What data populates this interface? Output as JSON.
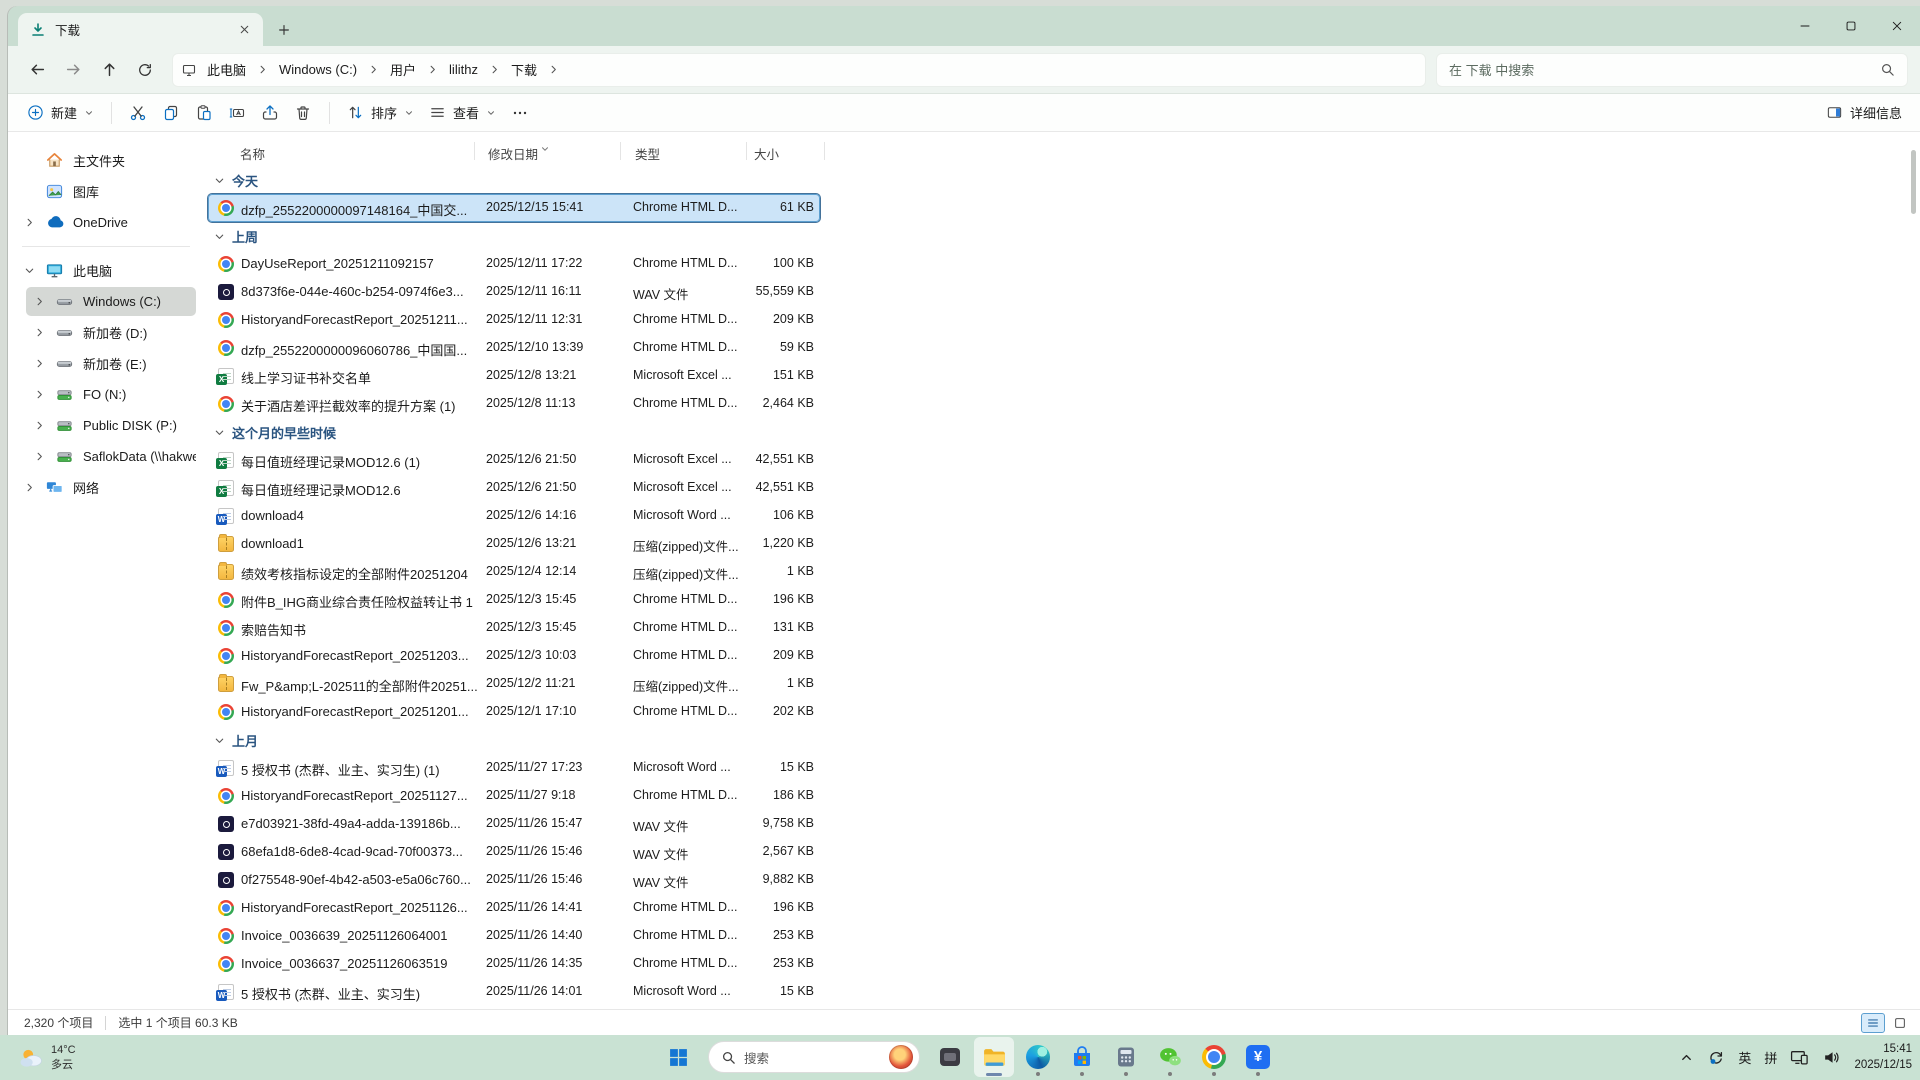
{
  "window": {
    "tab": {
      "icon": "download-icon",
      "label": "下载"
    },
    "controls": {
      "minimize_icon": "minimize-icon",
      "maximize_icon": "maximize-icon",
      "close_icon": "close-icon"
    }
  },
  "breadcrumb": {
    "device_icon": "computer-icon",
    "items": [
      "此电脑",
      "Windows (C:)",
      "用户",
      "lilithz",
      "下载"
    ]
  },
  "search": {
    "placeholder": "在 下载 中搜索",
    "icon": "search-icon"
  },
  "toolbar": {
    "new": "新建",
    "sort": "排序",
    "view": "查看",
    "details": "详细信息",
    "icons": [
      "new-plus-icon",
      "cut-icon",
      "copy-icon",
      "paste-icon",
      "rename-icon",
      "share-icon",
      "delete-icon",
      "sort-icon",
      "view-list-icon",
      "more-icon",
      "details-pane-icon"
    ]
  },
  "columns": {
    "name": "名称",
    "date": "修改日期",
    "type": "类型",
    "size": "大小"
  },
  "sidebar": {
    "items": [
      {
        "label": "主文件夹",
        "icon": "home-icon",
        "indent": 1,
        "chevron": ""
      },
      {
        "label": "图库",
        "icon": "gallery-icon",
        "indent": 1,
        "chevron": ""
      },
      {
        "label": "OneDrive",
        "icon": "onedrive-icon",
        "indent": 1,
        "chevron": "right",
        "divider_after": true
      },
      {
        "label": "此电脑",
        "icon": "pc-icon",
        "indent": 1,
        "chevron": "down"
      },
      {
        "label": "Windows (C:)",
        "icon": "drive-icon",
        "indent": 2,
        "chevron": "right",
        "selected": true
      },
      {
        "label": "新加卷 (D:)",
        "icon": "drive-icon",
        "indent": 2,
        "chevron": "right"
      },
      {
        "label": "新加卷 (E:)",
        "icon": "drive-icon",
        "indent": 2,
        "chevron": "right"
      },
      {
        "label": "FO (N:)",
        "icon": "network-drive-icon",
        "indent": 2,
        "chevron": "right"
      },
      {
        "label": "Public DISK (P:)",
        "icon": "network-drive-icon",
        "indent": 2,
        "chevron": "right"
      },
      {
        "label": "SaflokData (\\\\hakwe",
        "icon": "network-drive-icon",
        "indent": 2,
        "chevron": "right"
      },
      {
        "label": "网络",
        "icon": "network-icon",
        "indent": 1,
        "chevron": "right"
      }
    ]
  },
  "files": {
    "groups": [
      {
        "label": "今天",
        "rows": [
          {
            "name": "dzfp_2552200000097148164_中国交...",
            "date": "2025/12/15 15:41",
            "type": "Chrome HTML D...",
            "size": "61 KB",
            "kind": "chrome",
            "selected": true
          }
        ]
      },
      {
        "label": "上周",
        "rows": [
          {
            "name": "DayUseReport_20251211092157",
            "date": "2025/12/11 17:22",
            "type": "Chrome HTML D...",
            "size": "100 KB",
            "kind": "chrome"
          },
          {
            "name": "8d373f6e-044e-460c-b254-0974f6e3...",
            "date": "2025/12/11 16:11",
            "type": "WAV 文件",
            "size": "55,559 KB",
            "kind": "wav"
          },
          {
            "name": "HistoryandForecastReport_20251211...",
            "date": "2025/12/11 12:31",
            "type": "Chrome HTML D...",
            "size": "209 KB",
            "kind": "chrome"
          },
          {
            "name": "dzfp_2552200000096060786_中国国...",
            "date": "2025/12/10 13:39",
            "type": "Chrome HTML D...",
            "size": "59 KB",
            "kind": "chrome"
          },
          {
            "name": "线上学习证书补交名单",
            "date": "2025/12/8 13:21",
            "type": "Microsoft Excel ...",
            "size": "151 KB",
            "kind": "excel"
          },
          {
            "name": "关于酒店差评拦截效率的提升方案 (1)",
            "date": "2025/12/8 11:13",
            "type": "Chrome HTML D...",
            "size": "2,464 KB",
            "kind": "chrome"
          }
        ]
      },
      {
        "label": "这个月的早些时候",
        "rows": [
          {
            "name": "每日值班经理记录MOD12.6 (1)",
            "date": "2025/12/6 21:50",
            "type": "Microsoft Excel ...",
            "size": "42,551 KB",
            "kind": "excel"
          },
          {
            "name": "每日值班经理记录MOD12.6",
            "date": "2025/12/6 21:50",
            "type": "Microsoft Excel ...",
            "size": "42,551 KB",
            "kind": "excel"
          },
          {
            "name": "download4",
            "date": "2025/12/6 14:16",
            "type": "Microsoft Word ...",
            "size": "106 KB",
            "kind": "word"
          },
          {
            "name": "download1",
            "date": "2025/12/6 13:21",
            "type": "压缩(zipped)文件...",
            "size": "1,220 KB",
            "kind": "zip"
          },
          {
            "name": "绩效考核指标设定的全部附件20251204",
            "date": "2025/12/4 12:14",
            "type": "压缩(zipped)文件...",
            "size": "1 KB",
            "kind": "zip"
          },
          {
            "name": "附件B_IHG商业综合责任险权益转让书 1",
            "date": "2025/12/3 15:45",
            "type": "Chrome HTML D...",
            "size": "196 KB",
            "kind": "chrome"
          },
          {
            "name": "索赔告知书",
            "date": "2025/12/3 15:45",
            "type": "Chrome HTML D...",
            "size": "131 KB",
            "kind": "chrome"
          },
          {
            "name": "HistoryandForecastReport_20251203...",
            "date": "2025/12/3 10:03",
            "type": "Chrome HTML D...",
            "size": "209 KB",
            "kind": "chrome"
          },
          {
            "name": "Fw_P&amp;L-202511的全部附件20251...",
            "date": "2025/12/2 11:21",
            "type": "压缩(zipped)文件...",
            "size": "1 KB",
            "kind": "zip"
          },
          {
            "name": "HistoryandForecastReport_20251201...",
            "date": "2025/12/1 17:10",
            "type": "Chrome HTML D...",
            "size": "202 KB",
            "kind": "chrome"
          }
        ]
      },
      {
        "label": "上月",
        "rows": [
          {
            "name": "5 授权书 (杰群、业主、实习生) (1)",
            "date": "2025/11/27 17:23",
            "type": "Microsoft Word ...",
            "size": "15 KB",
            "kind": "word"
          },
          {
            "name": "HistoryandForecastReport_20251127...",
            "date": "2025/11/27 9:18",
            "type": "Chrome HTML D...",
            "size": "186 KB",
            "kind": "chrome"
          },
          {
            "name": "e7d03921-38fd-49a4-adda-139186b...",
            "date": "2025/11/26 15:47",
            "type": "WAV 文件",
            "size": "9,758 KB",
            "kind": "wav"
          },
          {
            "name": "68efa1d8-6de8-4cad-9cad-70f00373...",
            "date": "2025/11/26 15:46",
            "type": "WAV 文件",
            "size": "2,567 KB",
            "kind": "wav"
          },
          {
            "name": "0f275548-90ef-4b42-a503-e5a06c760...",
            "date": "2025/11/26 15:46",
            "type": "WAV 文件",
            "size": "9,882 KB",
            "kind": "wav"
          },
          {
            "name": "HistoryandForecastReport_20251126...",
            "date": "2025/11/26 14:41",
            "type": "Chrome HTML D...",
            "size": "196 KB",
            "kind": "chrome"
          },
          {
            "name": "Invoice_0036639_20251126064001",
            "date": "2025/11/26 14:40",
            "type": "Chrome HTML D...",
            "size": "253 KB",
            "kind": "chrome"
          },
          {
            "name": "Invoice_0036637_20251126063519",
            "date": "2025/11/26 14:35",
            "type": "Chrome HTML D...",
            "size": "253 KB",
            "kind": "chrome"
          },
          {
            "name": "5 授权书 (杰群、业主、实习生)",
            "date": "2025/11/26 14:01",
            "type": "Microsoft Word ...",
            "size": "15 KB",
            "kind": "word"
          }
        ]
      }
    ]
  },
  "status": {
    "items_count": "2,320 个项目",
    "selection": "选中 1 个项目 60.3 KB"
  },
  "taskbar": {
    "weather": {
      "temp": "14°C",
      "condition": "多云",
      "icon": "weather-cloudy-icon"
    },
    "start_icon": "start-icon",
    "search_label": "搜索",
    "apps": [
      {
        "icon": "task-view-icon"
      },
      {
        "icon": "file-explorer-icon",
        "active": true
      },
      {
        "icon": "edge-icon",
        "dot": true
      },
      {
        "icon": "microsoft-store-icon",
        "dot": true
      },
      {
        "icon": "calculator-icon",
        "dot": true
      },
      {
        "icon": "wechat-icon",
        "dot": true
      },
      {
        "icon": "chrome-icon",
        "dot": true
      },
      {
        "icon": "yuan-app-icon",
        "dot": true
      }
    ],
    "tray": {
      "lang_en": "英",
      "lang_pinyin": "拼"
    },
    "clock": {
      "time": "15:41",
      "date": "2025/12/15"
    }
  }
}
